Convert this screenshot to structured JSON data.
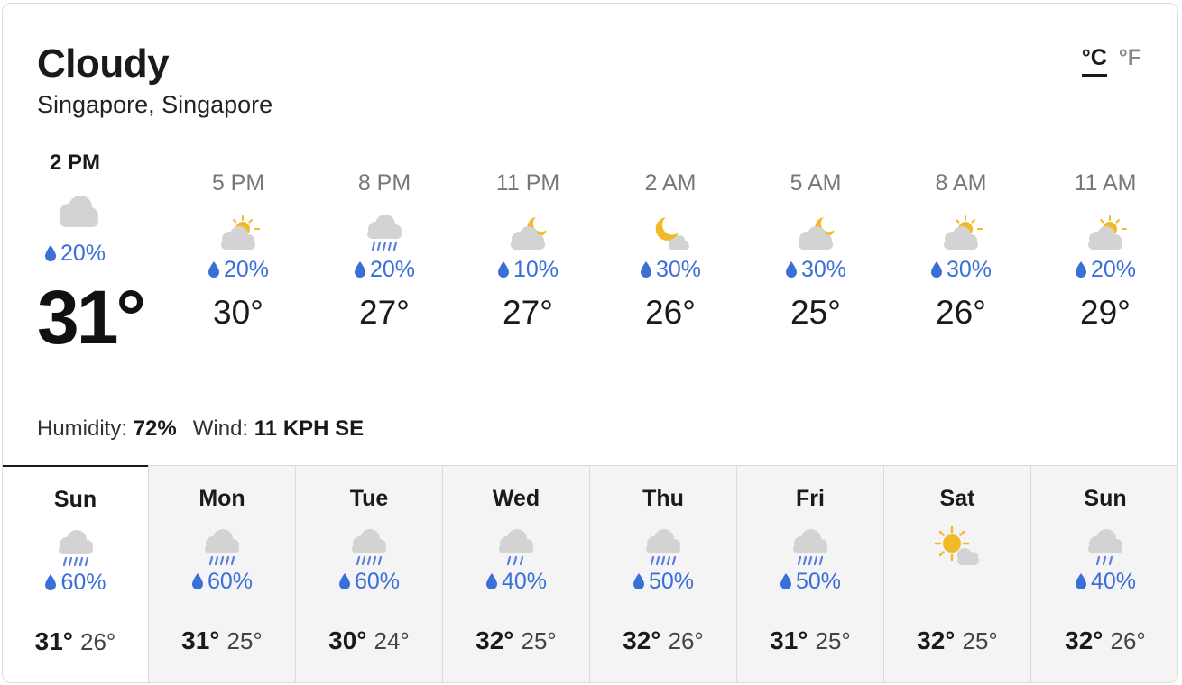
{
  "condition": "Cloudy",
  "location": "Singapore, Singapore",
  "units": {
    "celsius": "°C",
    "fahrenheit": "°F"
  },
  "now": {
    "time": "2 PM",
    "icon": "cloudy-icon",
    "precip": "20%",
    "temp": "31°"
  },
  "hourly": [
    {
      "time": "5 PM",
      "icon": "partly-sunny-icon",
      "precip": "20%",
      "temp": "30°"
    },
    {
      "time": "8 PM",
      "icon": "rain-icon",
      "precip": "20%",
      "temp": "27°"
    },
    {
      "time": "11 PM",
      "icon": "partly-cloudy-night-icon",
      "precip": "10%",
      "temp": "27°"
    },
    {
      "time": "2 AM",
      "icon": "mostly-clear-night-icon",
      "precip": "30%",
      "temp": "26°"
    },
    {
      "time": "5 AM",
      "icon": "partly-cloudy-night-icon",
      "precip": "30%",
      "temp": "25°"
    },
    {
      "time": "8 AM",
      "icon": "partly-sunny-icon",
      "precip": "30%",
      "temp": "26°"
    },
    {
      "time": "11 AM",
      "icon": "partly-sunny-icon",
      "precip": "20%",
      "temp": "29°"
    }
  ],
  "details": {
    "humidity_label": "Humidity:",
    "humidity": "72%",
    "wind_label": "Wind:",
    "wind": "11 KPH SE"
  },
  "daily": [
    {
      "day": "Sun",
      "icon": "rain-icon",
      "precip": "60%",
      "high": "31°",
      "low": "26°"
    },
    {
      "day": "Mon",
      "icon": "rain-icon",
      "precip": "60%",
      "high": "31°",
      "low": "25°"
    },
    {
      "day": "Tue",
      "icon": "rain-icon",
      "precip": "60%",
      "high": "30°",
      "low": "24°"
    },
    {
      "day": "Wed",
      "icon": "light-rain-icon",
      "precip": "40%",
      "high": "32°",
      "low": "25°"
    },
    {
      "day": "Thu",
      "icon": "rain-icon",
      "precip": "50%",
      "high": "32°",
      "low": "26°"
    },
    {
      "day": "Fri",
      "icon": "rain-icon",
      "precip": "50%",
      "high": "31°",
      "low": "25°"
    },
    {
      "day": "Sat",
      "icon": "mostly-sunny-icon",
      "precip": "",
      "high": "32°",
      "low": "25°"
    },
    {
      "day": "Sun",
      "icon": "light-rain-icon",
      "precip": "40%",
      "high": "32°",
      "low": "26°"
    }
  ],
  "colors": {
    "precip": "#3b6fd8",
    "sun": "#f2b929",
    "cloud": "#d3d3d3",
    "rain": "#5b7ee0",
    "active_day_bg": "#ffffff",
    "day_bg": "#f4f4f4"
  }
}
